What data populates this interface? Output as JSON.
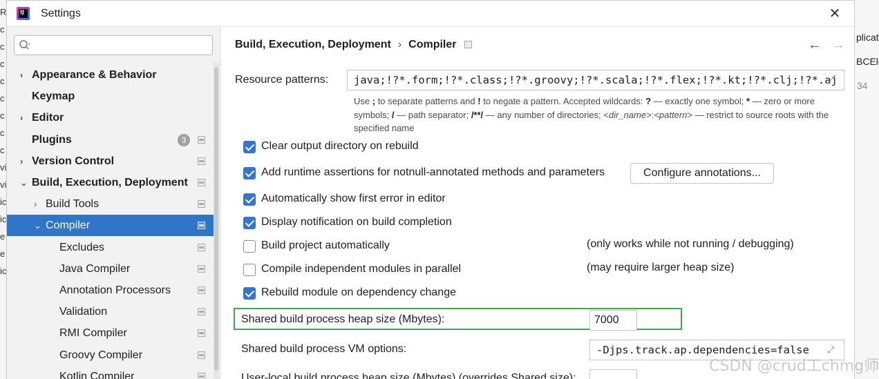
{
  "background": {
    "left_chars": [
      "R",
      "c",
      "c",
      "c",
      "c",
      "c",
      "c",
      "c",
      "c",
      "vi",
      "vi",
      "ic",
      "ic",
      "e",
      "e",
      "ic"
    ],
    "right_texts": [
      "plicat",
      "BCEle",
      "34"
    ]
  },
  "window": {
    "title": "Settings",
    "close_glyph": "✕"
  },
  "sidebar": {
    "search_placeholder": "",
    "items": [
      {
        "label": "Appearance & Behavior",
        "arrow": "›",
        "bold": true
      },
      {
        "label": "Keymap",
        "arrow": "",
        "bold": true
      },
      {
        "label": "Editor",
        "arrow": "›",
        "bold": true
      },
      {
        "label": "Plugins",
        "arrow": "",
        "bold": true,
        "badge": "3"
      },
      {
        "label": "Version Control",
        "arrow": "›",
        "bold": true
      },
      {
        "label": "Build, Execution, Deployment",
        "arrow": "⌄",
        "bold": true
      },
      {
        "label": "Build Tools",
        "arrow": "›",
        "bold": false
      },
      {
        "label": "Compiler",
        "arrow": "⌄",
        "bold": false,
        "selected": true
      },
      {
        "label": "Excludes",
        "arrow": "",
        "bold": false
      },
      {
        "label": "Java Compiler",
        "arrow": "",
        "bold": false
      },
      {
        "label": "Annotation Processors",
        "arrow": "",
        "bold": false
      },
      {
        "label": "Validation",
        "arrow": "",
        "bold": false
      },
      {
        "label": "RMI Compiler",
        "arrow": "",
        "bold": false
      },
      {
        "label": "Groovy Compiler",
        "arrow": "",
        "bold": false
      },
      {
        "label": "Kotlin Compiler",
        "arrow": "",
        "bold": false
      }
    ]
  },
  "header": {
    "crumb_parent": "Build, Execution, Deployment",
    "crumb_sep": "›",
    "crumb_current": "Compiler",
    "back_glyph": "←",
    "forward_glyph": "→"
  },
  "resource": {
    "label": "Resource patterns:",
    "value": "java;!?*.form;!?*.class;!?*.groovy;!?*.scala;!?*.flex;!?*.kt;!?*.clj;!?*.aj",
    "hint_parts": {
      "p1": "Use ",
      "semi": ";",
      "p2": " to separate patterns and ",
      "bang": "!",
      "p3": " to negate a pattern. Accepted wildcards: ",
      "q": "?",
      "p4": " — exactly one symbol; ",
      "star": "*",
      "p5": " — zero or more symbols; ",
      "slash": "/",
      "p6": " — path separator; ",
      "dstar": "/**/",
      "p7": " — any number of directories; ",
      "dirname": "<dir_name>",
      "colon": ":",
      "pattern": "<pattern>",
      "p8": " — restrict to source roots with the specified name"
    }
  },
  "options": [
    {
      "label": "Clear output directory on rebuild",
      "checked": true
    },
    {
      "label": "Add runtime assertions for notnull-annotated methods and parameters",
      "checked": true
    },
    {
      "label": "Automatically show first error in editor",
      "checked": true
    },
    {
      "label": "Display notification on build completion",
      "checked": true
    },
    {
      "label": "Build project automatically",
      "checked": false,
      "note": "(only works while not running / debugging)"
    },
    {
      "label": "Compile independent modules in parallel",
      "checked": false,
      "note": "(may require larger heap size)"
    },
    {
      "label": "Rebuild module on dependency change",
      "checked": true
    }
  ],
  "configure_button": "Configure annotations...",
  "heap": {
    "label": "Shared build process heap size (Mbytes):",
    "value": "7000"
  },
  "vm": {
    "label": "Shared build process VM options:",
    "value": "-Djps.track.ap.dependencies=false"
  },
  "user_heap": {
    "label": "User-local build process heap size (Mbytes) (overrides Shared size):",
    "value": ""
  },
  "watermark": "CSDN @crud工chmg师"
}
